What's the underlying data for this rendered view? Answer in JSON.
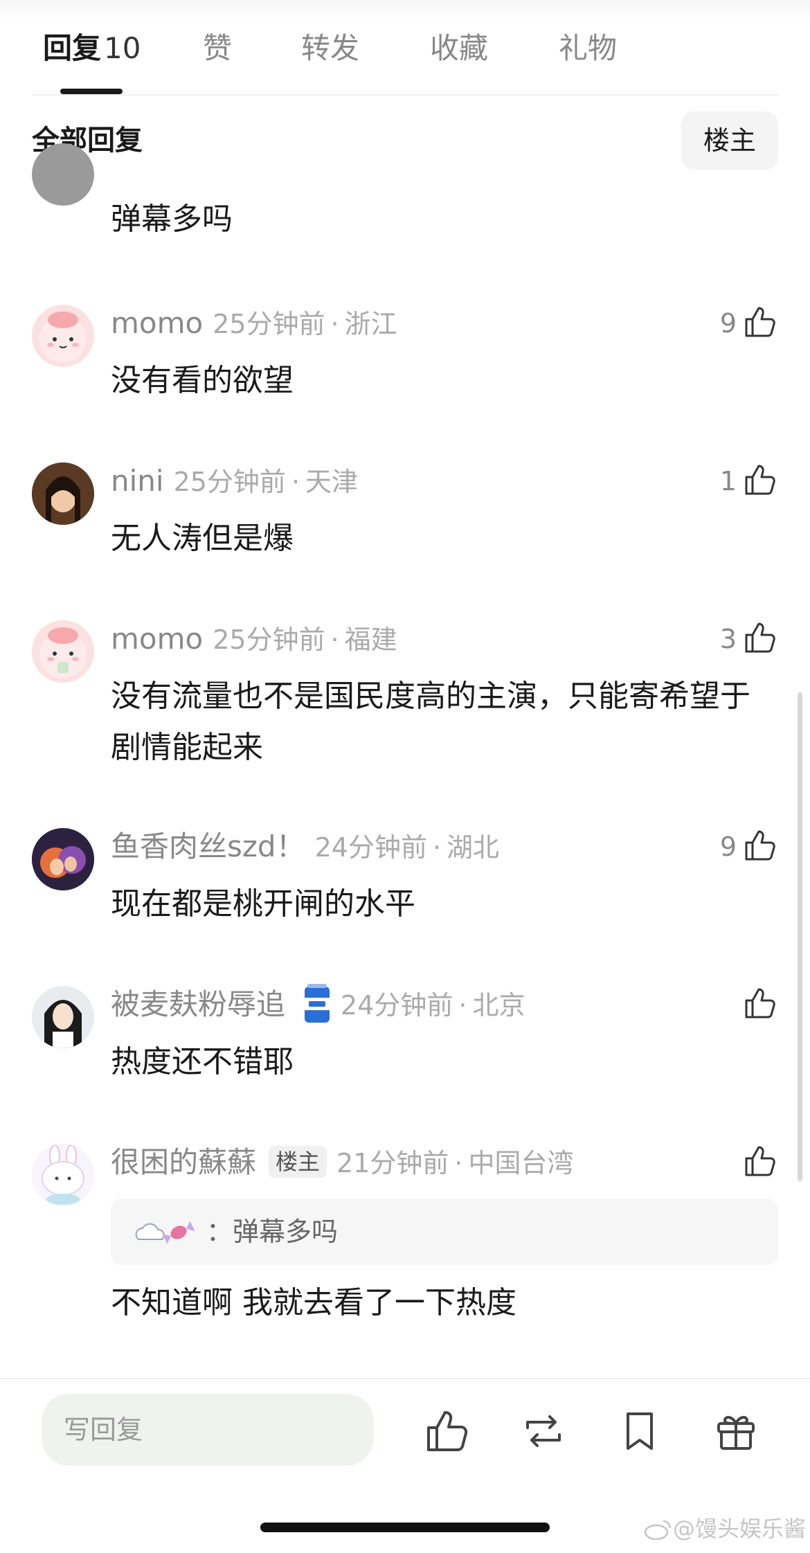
{
  "tabs": [
    {
      "label": "回复",
      "count": "10"
    },
    {
      "label": "赞"
    },
    {
      "label": "转发"
    },
    {
      "label": "收藏"
    },
    {
      "label": "礼物"
    }
  ],
  "section_title": "全部回复",
  "op_filter_label": "楼主",
  "comments": [
    {
      "content": "弹幕多吗"
    },
    {
      "username": "momo",
      "time": "25分钟前",
      "location": "浙江",
      "likes": "9",
      "content": "没有看的欲望"
    },
    {
      "username": "nini",
      "time": "25分钟前",
      "location": "天津",
      "likes": "1",
      "content": "无人涛但是爆"
    },
    {
      "username": "momo",
      "time": "25分钟前",
      "location": "福建",
      "likes": "3",
      "content": "没有流量也不是国民度高的主演，只能寄希望于剧情能起来"
    },
    {
      "username": "鱼香肉丝szd！",
      "time": "24分钟前",
      "location": "湖北",
      "likes": "9",
      "content": "现在都是桃开闸的水平"
    },
    {
      "username": "被麦麸粉辱追",
      "time": "24分钟前",
      "location": "北京",
      "likes": "",
      "content": "热度还不错耶"
    },
    {
      "username": "很困的蘇蘇",
      "badge": "楼主",
      "time": "21分钟前",
      "location": "中国台湾",
      "likes": "",
      "quote_text": "：弹幕多吗",
      "content": "不知道啊 我就去看了一下热度"
    }
  ],
  "meta_separator": "·",
  "reply_placeholder": "写回复",
  "watermark": "@馒头娱乐酱",
  "icons": {
    "like": "thumbs-up-icon",
    "repost": "repost-icon",
    "bookmark": "bookmark-icon",
    "gift": "gift-icon"
  },
  "colors": {
    "text_primary": "#1a1a1a",
    "text_secondary": "#888888",
    "input_bg": "#eef3ee"
  }
}
